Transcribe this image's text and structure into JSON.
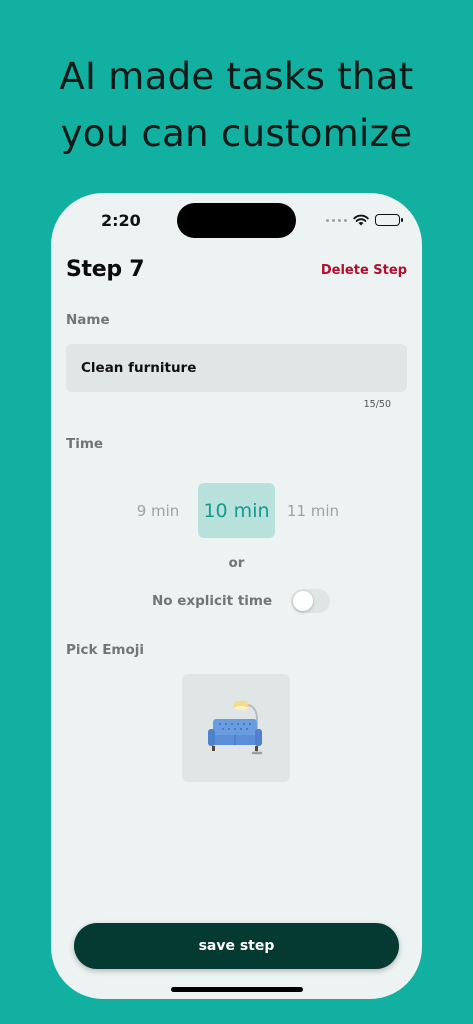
{
  "headline": {
    "line1": "AI made tasks that",
    "line2": "you can customize"
  },
  "status_bar": {
    "time": "2:20",
    "icons": [
      "cellular-signal-icon",
      "wifi-icon",
      "battery-icon"
    ]
  },
  "header": {
    "title": "Step 7",
    "delete_label": "Delete Step"
  },
  "name_section": {
    "label": "Name",
    "value": "Clean furniture",
    "counter": "15/50"
  },
  "time_section": {
    "label": "Time",
    "options": [
      "9 min",
      "10 min",
      "11 min"
    ],
    "selected": "10 min",
    "or_text": "or",
    "no_time_label": "No explicit time",
    "no_time_enabled": false
  },
  "emoji_section": {
    "label": "Pick Emoji",
    "emoji": "couch-and-lamp"
  },
  "save_label": "save step",
  "colors": {
    "background": "#12b0a0",
    "phone_bg": "#ecf3f2",
    "accent": "#169a8c",
    "delete": "#b01030",
    "button": "#053a33"
  }
}
